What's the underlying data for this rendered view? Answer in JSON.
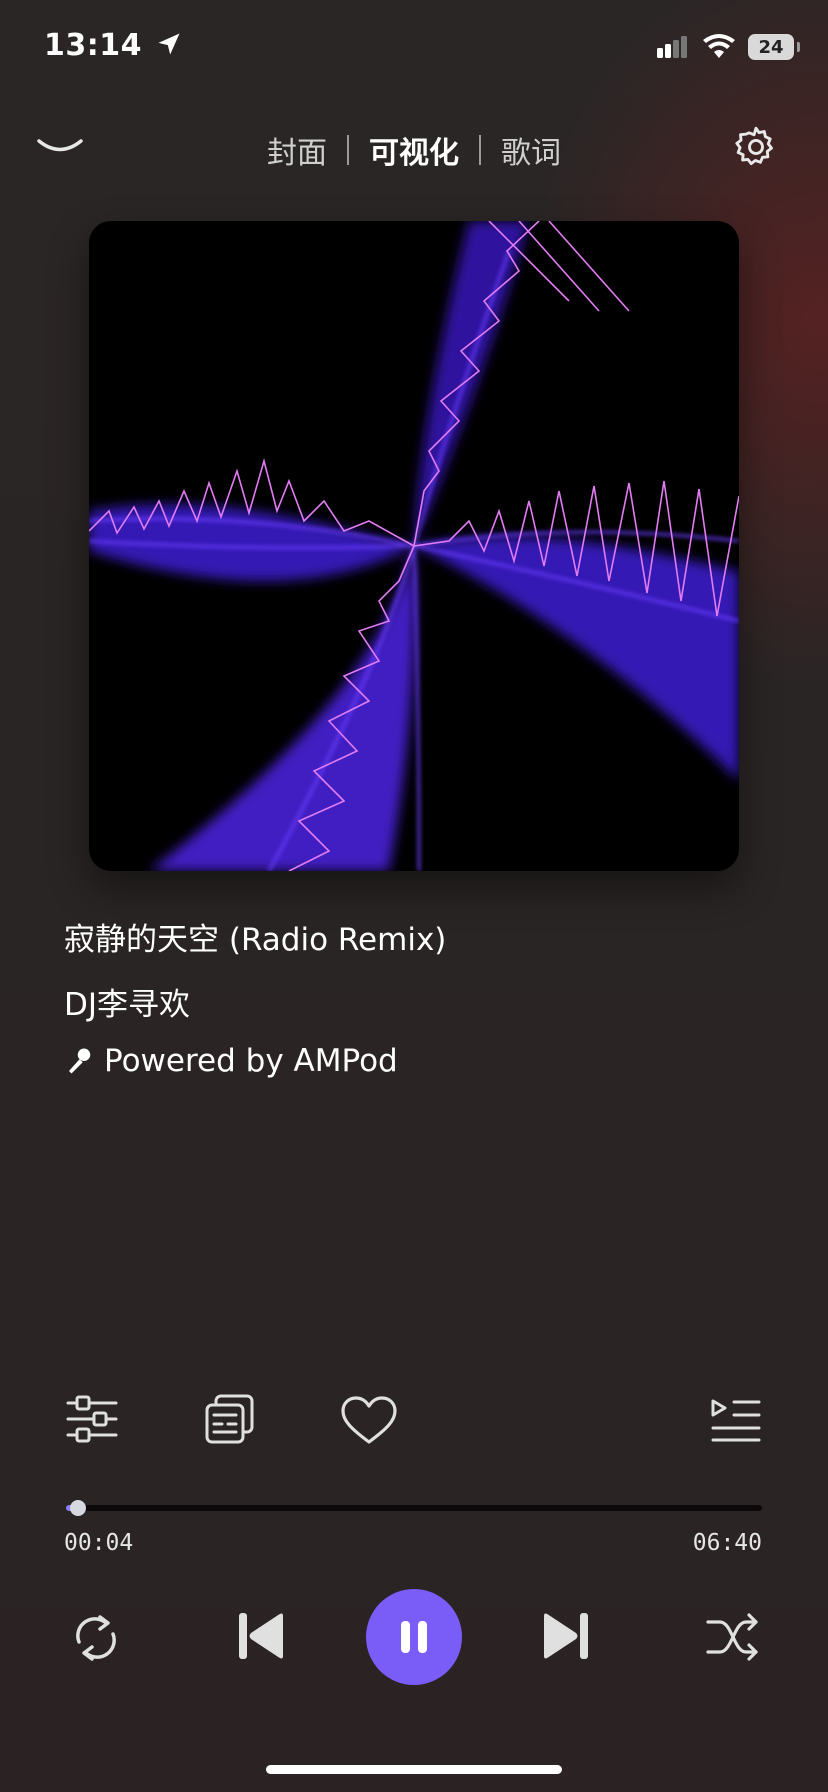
{
  "status_bar": {
    "time": "13:14",
    "battery": "24"
  },
  "nav": {
    "tabs": [
      {
        "label": "封面",
        "active": false
      },
      {
        "label": "可视化",
        "active": true
      },
      {
        "label": "歌词",
        "active": false
      }
    ]
  },
  "track": {
    "title": "寂静的天空 (Radio Remix)",
    "artist": "DJ李寻欢",
    "source": "Powered by AMPod"
  },
  "progress": {
    "elapsed": "00:04",
    "duration": "06:40",
    "fraction": 0.0167
  },
  "colors": {
    "accent": "#7a5cf7",
    "progress_fill": "#8b7cf8",
    "background": "#2a2525"
  },
  "icons": {
    "collapse": "chevron-down-icon",
    "settings": "gear-icon",
    "equalizer": "equalizer-icon",
    "cards": "cards-icon",
    "like": "heart-icon",
    "queue": "queue-icon",
    "repeat": "repeat-icon",
    "previous": "previous-icon",
    "pause": "pause-icon",
    "next": "next-icon",
    "shuffle": "shuffle-icon",
    "microphone": "microphone-icon"
  }
}
